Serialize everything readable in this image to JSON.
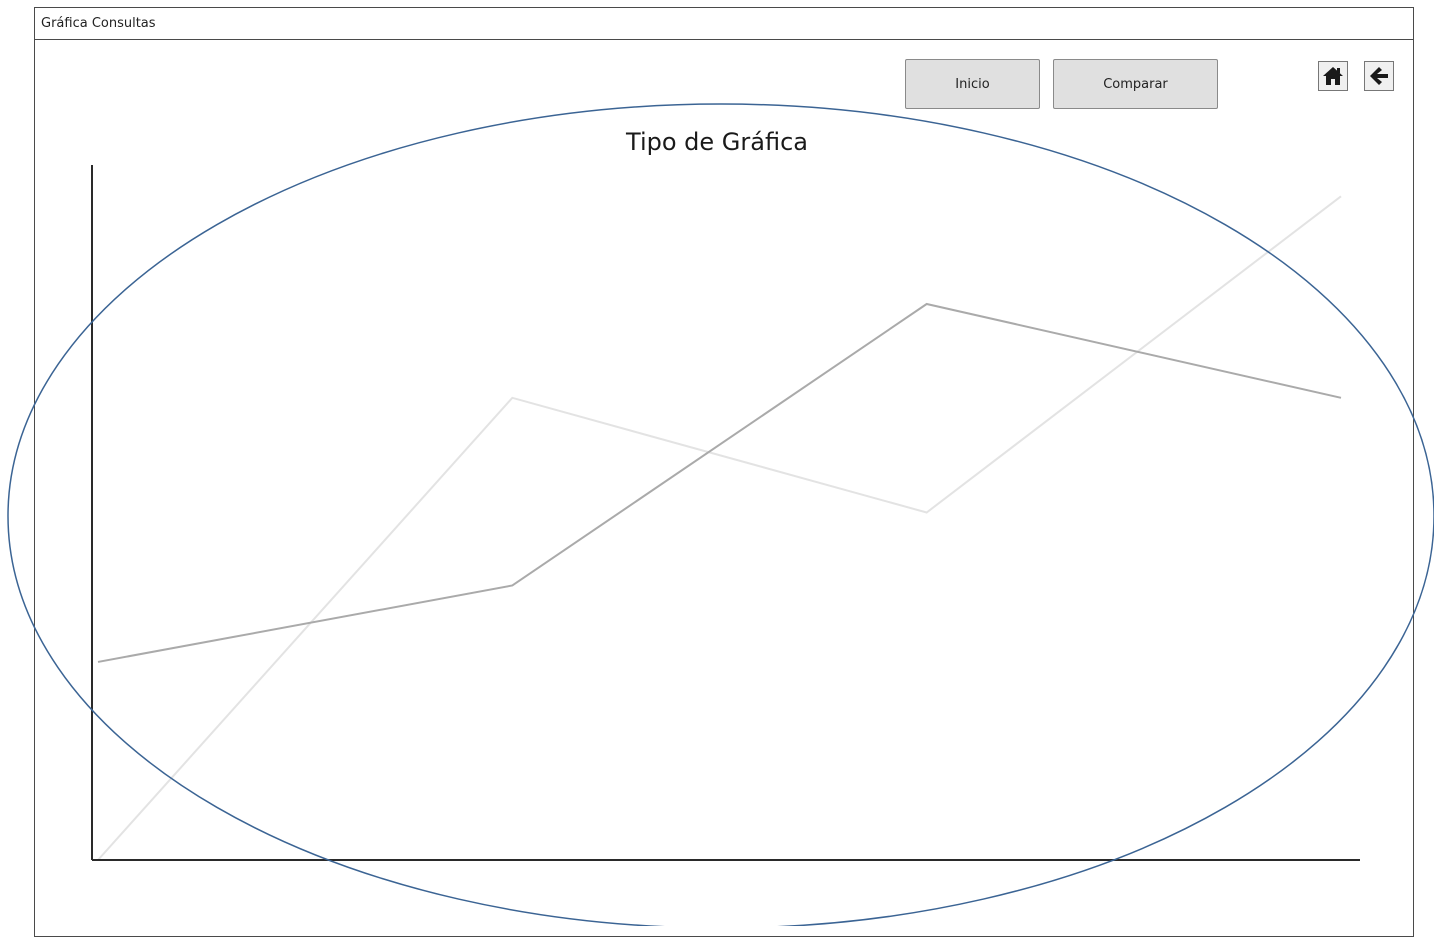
{
  "window": {
    "title": "Gráfica Consultas"
  },
  "toolbar": {
    "inicio_label": "Inicio",
    "comparar_label": "Comparar",
    "home_icon": "home-icon",
    "back_icon": "arrow-left-icon"
  },
  "chart_data": {
    "type": "line",
    "title": "Tipo de Gráfica",
    "xlabel": "",
    "ylabel": "",
    "x": [
      0,
      1,
      2,
      3
    ],
    "ylim": [
      0,
      100
    ],
    "grid": false,
    "series": [
      {
        "values": [
          28.5,
          39.5,
          80.0,
          66.5
        ],
        "color": "#aaaaaa"
      },
      {
        "values": [
          0.0,
          66.5,
          50.0,
          95.5
        ],
        "color": "#e3e3e3"
      }
    ]
  },
  "annotation": {
    "shape": "ellipse",
    "color": "#3b6494"
  }
}
